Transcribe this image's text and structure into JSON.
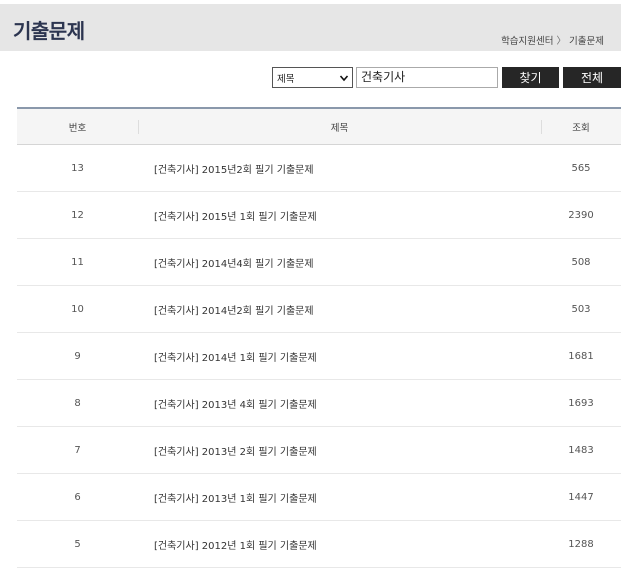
{
  "header": {
    "title": "기출문제",
    "breadcrumb": [
      "학습지원센터",
      "기출문제"
    ],
    "breadcrumb_sep": "〉"
  },
  "search": {
    "field_selected": "제목",
    "query": "건축기사",
    "search_label": "찾기",
    "all_label": "전체"
  },
  "table": {
    "columns": [
      "번호",
      "제목",
      "조회"
    ],
    "rows": [
      {
        "no": "13",
        "title": "[건축기사] 2015년2회 필기 기출문제",
        "views": "565"
      },
      {
        "no": "12",
        "title": "[건축기사] 2015년 1회 필기 기출문제",
        "views": "2390"
      },
      {
        "no": "11",
        "title": "[건축기사] 2014년4회 필기 기출문제",
        "views": "508"
      },
      {
        "no": "10",
        "title": "[건축기사] 2014년2회 필기 기출문제",
        "views": "503"
      },
      {
        "no": "9",
        "title": "[건축기사] 2014년 1회 필기 기출문제",
        "views": "1681"
      },
      {
        "no": "8",
        "title": "[건축기사] 2013년 4회 필기 기출문제",
        "views": "1693"
      },
      {
        "no": "7",
        "title": "[건축기사] 2013년 2회 필기 기출문제",
        "views": "1483"
      },
      {
        "no": "6",
        "title": "[건축기사] 2013년 1회 필기 기출문제",
        "views": "1447"
      },
      {
        "no": "5",
        "title": "[건축기사] 2012년 1회 필기 기출문제",
        "views": "1288"
      }
    ]
  },
  "colors": {
    "header_bg": "#e6e6e6",
    "title": "#2c3550",
    "button_bg": "#262626",
    "table_top_border": "#8a98ab"
  },
  "icons": {
    "select_toggle": "chevron-down-icon"
  }
}
